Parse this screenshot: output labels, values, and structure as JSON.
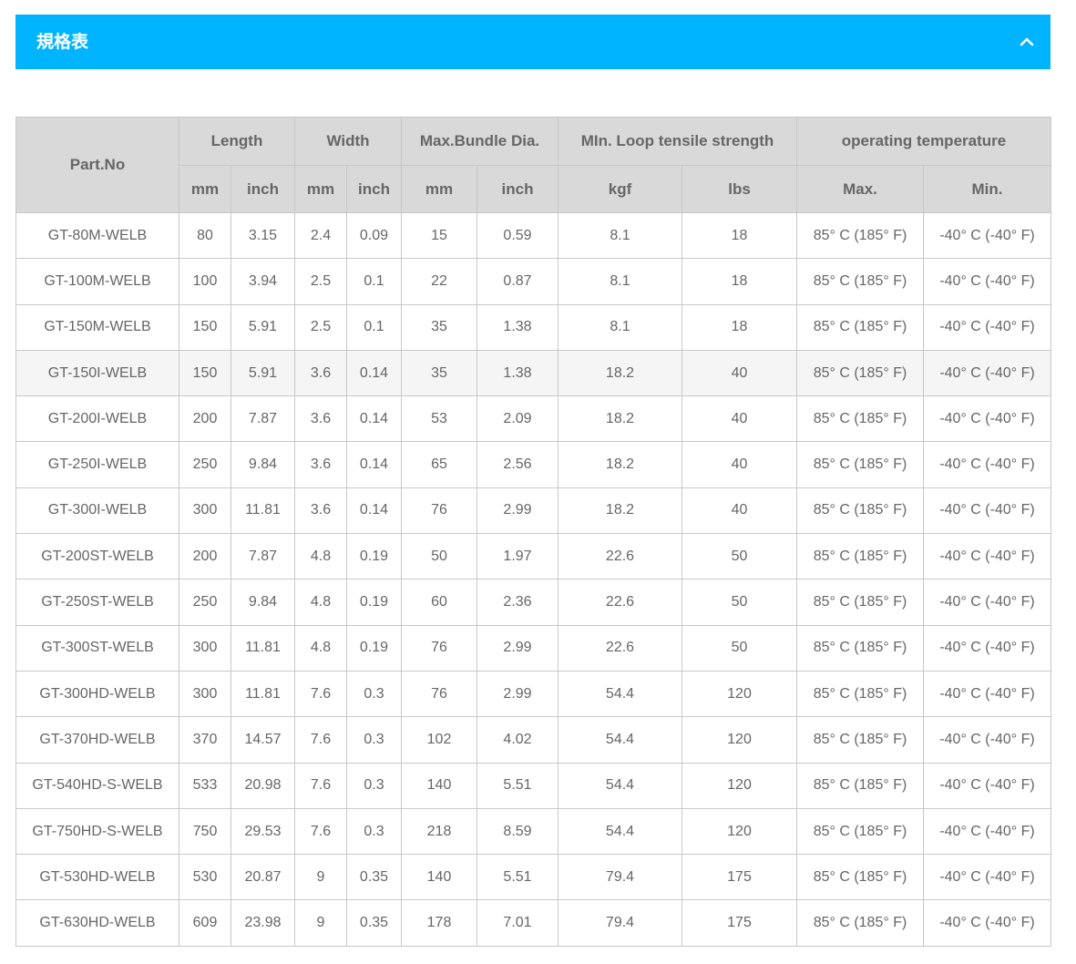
{
  "accordion": {
    "title": "規格表",
    "expanded": true,
    "background": "#00b4ff",
    "icon": "chevron-up-icon"
  },
  "table": {
    "headers": {
      "part_no": "Part.No",
      "length": "Length",
      "width": "Width",
      "max_bundle_dia": "Max.Bundle Dia.",
      "min_loop_tensile": "MIn. Loop tensile strength",
      "operating_temperature": "operating temperature"
    },
    "subheaders": {
      "length_mm": "mm",
      "length_inch": "inch",
      "width_mm": "mm",
      "width_inch": "inch",
      "bundle_mm": "mm",
      "bundle_inch": "inch",
      "tensile_kgf": "kgf",
      "tensile_lbs": "lbs",
      "temp_max": "Max.",
      "temp_min": "Min."
    },
    "rows": [
      [
        "GT-80M-WELB",
        "80",
        "3.15",
        "2.4",
        "0.09",
        "15",
        "0.59",
        "8.1",
        "18",
        "85° C (185° F)",
        "-40° C (-40° F)"
      ],
      [
        "GT-100M-WELB",
        "100",
        "3.94",
        "2.5",
        "0.1",
        "22",
        "0.87",
        "8.1",
        "18",
        "85° C (185° F)",
        "-40° C (-40° F)"
      ],
      [
        "GT-150M-WELB",
        "150",
        "5.91",
        "2.5",
        "0.1",
        "35",
        "1.38",
        "8.1",
        "18",
        "85° C (185° F)",
        "-40° C (-40° F)"
      ],
      [
        "GT-150I-WELB",
        "150",
        "5.91",
        "3.6",
        "0.14",
        "35",
        "1.38",
        "18.2",
        "40",
        "85° C (185° F)",
        "-40° C (-40° F)"
      ],
      [
        "GT-200I-WELB",
        "200",
        "7.87",
        "3.6",
        "0.14",
        "53",
        "2.09",
        "18.2",
        "40",
        "85° C (185° F)",
        "-40° C (-40° F)"
      ],
      [
        "GT-250I-WELB",
        "250",
        "9.84",
        "3.6",
        "0.14",
        "65",
        "2.56",
        "18.2",
        "40",
        "85° C (185° F)",
        "-40° C (-40° F)"
      ],
      [
        "GT-300I-WELB",
        "300",
        "11.81",
        "3.6",
        "0.14",
        "76",
        "2.99",
        "18.2",
        "40",
        "85° C (185° F)",
        "-40° C (-40° F)"
      ],
      [
        "GT-200ST-WELB",
        "200",
        "7.87",
        "4.8",
        "0.19",
        "50",
        "1.97",
        "22.6",
        "50",
        "85° C (185° F)",
        "-40° C (-40° F)"
      ],
      [
        "GT-250ST-WELB",
        "250",
        "9.84",
        "4.8",
        "0.19",
        "60",
        "2.36",
        "22.6",
        "50",
        "85° C (185° F)",
        "-40° C (-40° F)"
      ],
      [
        "GT-300ST-WELB",
        "300",
        "11.81",
        "4.8",
        "0.19",
        "76",
        "2.99",
        "22.6",
        "50",
        "85° C (185° F)",
        "-40° C (-40° F)"
      ],
      [
        "GT-300HD-WELB",
        "300",
        "11.81",
        "7.6",
        "0.3",
        "76",
        "2.99",
        "54.4",
        "120",
        "85° C (185° F)",
        "-40° C (-40° F)"
      ],
      [
        "GT-370HD-WELB",
        "370",
        "14.57",
        "7.6",
        "0.3",
        "102",
        "4.02",
        "54.4",
        "120",
        "85° C (185° F)",
        "-40° C (-40° F)"
      ],
      [
        "GT-540HD-S-WELB",
        "533",
        "20.98",
        "7.6",
        "0.3",
        "140",
        "5.51",
        "54.4",
        "120",
        "85° C (185° F)",
        "-40° C (-40° F)"
      ],
      [
        "GT-750HD-S-WELB",
        "750",
        "29.53",
        "7.6",
        "0.3",
        "218",
        "8.59",
        "54.4",
        "120",
        "85° C (185° F)",
        "-40° C (-40° F)"
      ],
      [
        "GT-530HD-WELB",
        "530",
        "20.87",
        "9",
        "0.35",
        "140",
        "5.51",
        "79.4",
        "175",
        "85° C (185° F)",
        "-40° C (-40° F)"
      ],
      [
        "GT-630HD-WELB",
        "609",
        "23.98",
        "9",
        "0.35",
        "178",
        "7.01",
        "79.4",
        "175",
        "85° C (185° F)",
        "-40° C (-40° F)"
      ]
    ]
  }
}
